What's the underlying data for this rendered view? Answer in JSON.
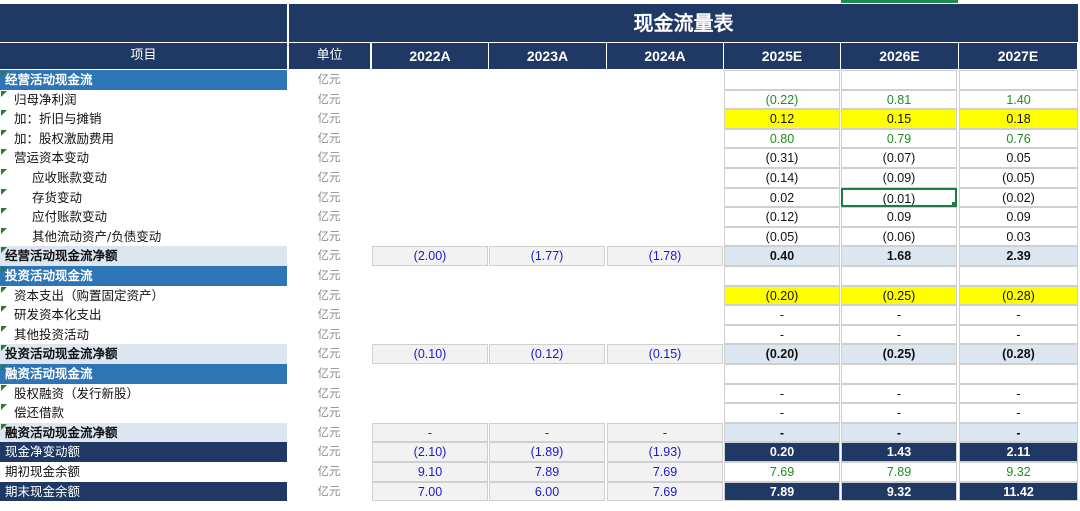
{
  "sheet": {
    "title": "现金流量表",
    "headers": {
      "item": "项目",
      "unit": "单位",
      "years": [
        "2022A",
        "2023A",
        "2024A",
        "2025E",
        "2026E",
        "2027E"
      ]
    },
    "rows": [
      {
        "label": "经营活动现金流",
        "style": "section",
        "unit": "亿元",
        "hist": [
          "",
          "",
          ""
        ],
        "est": [
          "",
          "",
          ""
        ]
      },
      {
        "label": "归母净利润",
        "style": "sub",
        "unit": "亿元",
        "hist": [
          "",
          "",
          ""
        ],
        "est": [
          "(0.22)",
          "0.81",
          "1.40"
        ],
        "est_color": "green"
      },
      {
        "label": "加：折旧与摊销",
        "style": "sub",
        "unit": "亿元",
        "hist": [
          "",
          "",
          ""
        ],
        "est": [
          "0.12",
          "0.15",
          "0.18"
        ],
        "est_bg": "yellow",
        "est_color": "black"
      },
      {
        "label": "加：股权激励费用",
        "style": "sub",
        "unit": "亿元",
        "hist": [
          "",
          "",
          ""
        ],
        "est": [
          "0.80",
          "0.79",
          "0.76"
        ],
        "est_color": "green"
      },
      {
        "label": "营运资本变动",
        "style": "sub",
        "unit": "亿元",
        "hist": [
          "",
          "",
          ""
        ],
        "est": [
          "(0.31)",
          "(0.07)",
          "0.05"
        ],
        "est_color": "black"
      },
      {
        "label": "应收账款变动",
        "style": "subsub",
        "unit": "亿元",
        "hist": [
          "",
          "",
          ""
        ],
        "est": [
          "(0.14)",
          "(0.09)",
          "(0.05)"
        ],
        "est_color": "black"
      },
      {
        "label": "存货变动",
        "style": "subsub",
        "unit": "亿元",
        "hist": [
          "",
          "",
          ""
        ],
        "est": [
          "0.02",
          "(0.01)",
          "(0.02)"
        ],
        "est_color": "black",
        "selected": 1
      },
      {
        "label": "应付账款变动",
        "style": "subsub",
        "unit": "亿元",
        "hist": [
          "",
          "",
          ""
        ],
        "est": [
          "(0.12)",
          "0.09",
          "0.09"
        ],
        "est_color": "black"
      },
      {
        "label": "其他流动资产/负债变动",
        "style": "subsub",
        "unit": "亿元",
        "hist": [
          "",
          "",
          ""
        ],
        "est": [
          "(0.05)",
          "(0.06)",
          "0.03"
        ],
        "est_color": "black"
      },
      {
        "label": "经营活动现金流净额",
        "style": "total",
        "unit": "亿元",
        "hist": [
          "(2.00)",
          "(1.77)",
          "(1.78)"
        ],
        "est": [
          "0.40",
          "1.68",
          "2.39"
        ],
        "est_bg": "total",
        "est_bold": true,
        "hist_bg": "total"
      },
      {
        "label": "投资活动现金流",
        "style": "section",
        "unit": "亿元",
        "hist": [
          "",
          "",
          ""
        ],
        "est": [
          "",
          "",
          ""
        ]
      },
      {
        "label": "资本支出（购置固定资产）",
        "style": "sub",
        "unit": "亿元",
        "hist": [
          "",
          "",
          ""
        ],
        "est": [
          "(0.20)",
          "(0.25)",
          "(0.28)"
        ],
        "est_bg": "yellow",
        "est_color": "black"
      },
      {
        "label": "研发资本化支出",
        "style": "sub",
        "unit": "亿元",
        "hist": [
          "",
          "",
          ""
        ],
        "est": [
          "-",
          "-",
          "-"
        ],
        "est_color": "black"
      },
      {
        "label": "其他投资活动",
        "style": "sub",
        "unit": "亿元",
        "hist": [
          "",
          "",
          ""
        ],
        "est": [
          "-",
          "-",
          "-"
        ],
        "est_color": "black"
      },
      {
        "label": "投资活动现金流净额",
        "style": "total",
        "unit": "亿元",
        "hist": [
          "(0.10)",
          "(0.12)",
          "(0.15)"
        ],
        "est": [
          "(0.20)",
          "(0.25)",
          "(0.28)"
        ],
        "est_bg": "total",
        "est_bold": true,
        "hist_bg": "total"
      },
      {
        "label": "融资活动现金流",
        "style": "section",
        "unit": "亿元",
        "hist": [
          "",
          "",
          ""
        ],
        "est": [
          "",
          "",
          ""
        ]
      },
      {
        "label": "股权融资（发行新股）",
        "style": "sub",
        "unit": "亿元",
        "hist": [
          "",
          "",
          ""
        ],
        "est": [
          "-",
          "-",
          "-"
        ],
        "est_color": "black"
      },
      {
        "label": "偿还借款",
        "style": "sub",
        "unit": "亿元",
        "hist": [
          "",
          "",
          ""
        ],
        "est": [
          "-",
          "-",
          "-"
        ],
        "est_color": "black"
      },
      {
        "label": "融资活动现金流净额",
        "style": "total",
        "unit": "亿元",
        "hist": [
          "-",
          "-",
          "-"
        ],
        "est": [
          "-",
          "-",
          "-"
        ],
        "est_bg": "total",
        "est_bold": true,
        "hist_bg": "total"
      },
      {
        "label": "现金净变动额",
        "style": "dark",
        "unit": "亿元",
        "hist": [
          "(2.10)",
          "(1.89)",
          "(1.93)"
        ],
        "est": [
          "0.20",
          "1.43",
          "2.11"
        ],
        "est_bg": "dark",
        "hist_bg": "total"
      },
      {
        "label": "期初现金余额",
        "style": "plain",
        "unit": "亿元",
        "hist": [
          "9.10",
          "7.89",
          "7.69"
        ],
        "est": [
          "7.69",
          "7.89",
          "9.32"
        ],
        "est_color": "green",
        "hist_bg": "total"
      },
      {
        "label": "期末现金余额",
        "style": "dark",
        "unit": "亿元",
        "hist": [
          "7.00",
          "6.00",
          "7.69"
        ],
        "est": [
          "7.89",
          "9.32",
          "11.42"
        ],
        "est_bg": "dark",
        "hist_bg": "total"
      }
    ]
  }
}
